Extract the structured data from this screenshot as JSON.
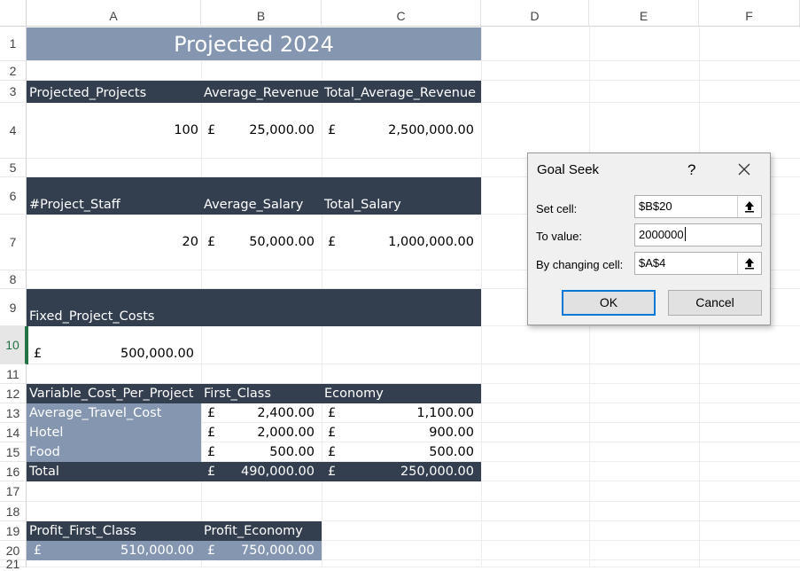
{
  "columns": [
    "A",
    "B",
    "C",
    "D",
    "E",
    "F"
  ],
  "rows": [
    "1",
    "2",
    "3",
    "4",
    "5",
    "6",
    "7",
    "8",
    "9",
    "10",
    "11",
    "12",
    "13",
    "14",
    "15",
    "16",
    "17",
    "18",
    "19",
    "20",
    "21"
  ],
  "active_row": "10",
  "sheet": {
    "title": "Projected 2024",
    "revenue": {
      "headers": [
        "Projected_Projects",
        "Average_Revenue",
        "Total_Average_Revenue"
      ],
      "projects": "100",
      "currency": "£",
      "avg_revenue": "25,000.00",
      "total_revenue": "2,500,000.00"
    },
    "staff": {
      "headers": [
        "#Project_Staff",
        "Average_Salary",
        "Total_Salary"
      ],
      "count": "20",
      "avg_salary": "50,000.00",
      "total_salary": "1,000,000.00"
    },
    "fixed": {
      "header": "Fixed_Project_Costs",
      "value": "500,000.00"
    },
    "variable": {
      "headers": [
        "Variable_Cost_Per_Project",
        "First_Class",
        "Economy"
      ],
      "rows": [
        {
          "label": "Average_Travel_Cost",
          "first": "2,400.00",
          "economy": "1,100.00"
        },
        {
          "label": "Hotel",
          "first": "2,000.00",
          "economy": "900.00"
        },
        {
          "label": "Food",
          "first": "500.00",
          "economy": "500.00"
        }
      ],
      "total_label": "Total",
      "total_first": "490,000.00",
      "total_economy": "250,000.00"
    },
    "profit": {
      "headers": [
        "Profit_First_Class",
        "Profit_Economy"
      ],
      "first": "510,000.00",
      "economy": "750,000.00"
    }
  },
  "dialog": {
    "title": "Goal Seek",
    "help": "?",
    "set_cell_label": "Set cell:",
    "set_cell_value": "$B$20",
    "to_value_label": "To value:",
    "to_value_value": "2000000",
    "changing_label": "By changing cell:",
    "changing_value": "$A$4",
    "ok": "OK",
    "cancel": "Cancel"
  },
  "colors": {
    "dark_band": "#333f4f",
    "steel_band": "#8496b0",
    "accent_green": "#217346",
    "dialog_focus": "#0078d7"
  }
}
